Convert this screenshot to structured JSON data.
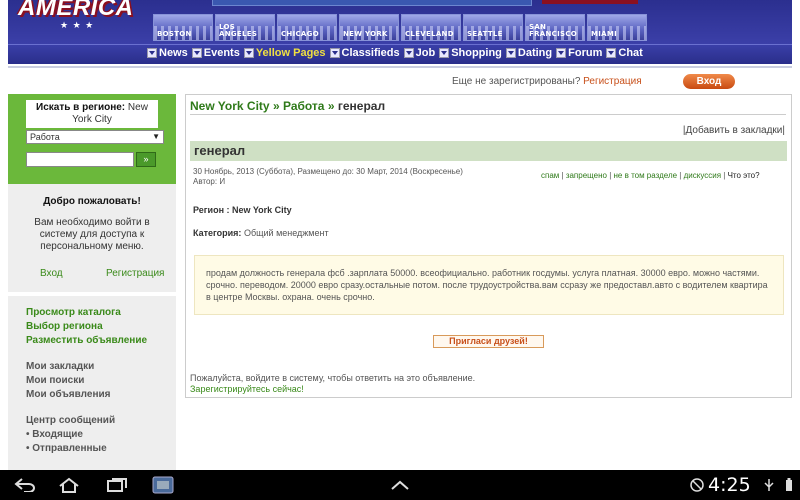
{
  "header": {
    "logo_text": "AMERICA",
    "logo_stars": "★ ★ ★",
    "cities": [
      "Boston",
      "Los Angeles",
      "Chicago",
      "New York",
      "Cleveland",
      "Seattle",
      "San Francisco",
      "Miami"
    ],
    "nav": [
      "News",
      "Events",
      "Yellow Pages",
      "Classifieds",
      "Job",
      "Shopping",
      "Dating",
      "Forum",
      "Chat"
    ],
    "nav_active": "Yellow Pages"
  },
  "login_strip": {
    "not_registered": "Еще не зарегистрированы?",
    "register_link": "Регистрация",
    "login_button": "Вход"
  },
  "sidebar": {
    "search_label": "Искать в регионе:",
    "search_region": "New York City",
    "category_select": "Работа",
    "search_go": "»",
    "welcome_title": "Добро пожаловать!",
    "welcome_text": "Вам необходимо войти в систему для доступа к персональному меню.",
    "login_link": "Вход",
    "register_link": "Регистрация",
    "menu_group1": [
      "Просмотр каталога",
      "Выбор региона",
      "Разместить объявление"
    ],
    "menu_group2": [
      "Мои закладки",
      "Мои поиски",
      "Мои объявления"
    ],
    "menu_group3_title": "Центр сообщений",
    "menu_group3": [
      "• Входящие",
      "• Отправленные"
    ]
  },
  "main": {
    "breadcrumb": [
      "New York City",
      "Работа",
      "генерал"
    ],
    "bookmark": "|Добавить в закладки|",
    "title": "генерал",
    "dates": "30 Ноябрь, 2013 (Суббота), Размещено до: 30 Март, 2014 (Воскресенье)",
    "author": "Автор: И",
    "actions": [
      "спам",
      "запрещено",
      "не в том разделе",
      "дискуссия"
    ],
    "what": "Что это?",
    "region_label": "Регион : New York City",
    "category_label": "Категория:",
    "category_value": "Общий менеджмент",
    "body": "продам должность генерала фсб .зарплата 50000. всеофициально. работник госдумы. услуга платная. 30000 евро. можно частями. срочно. переводом. 20000 евро сразу.остальные потом. после трудоустройства.вам ссразу же предоставл.авто с водителем квартира в центре Москвы. охрана. очень срочно.",
    "invite_button": "Пригласи друзей!",
    "login_note": "Пожалуйста, войдите в систему, чтобы ответить на это объявление.",
    "register_now": "Зарегистрируйтесь сейчас!"
  },
  "system_bar": {
    "time": "4:25",
    "icons": [
      "back-icon",
      "home-icon",
      "recent-apps-icon",
      "screenshot-icon",
      "menu-up-icon",
      "no-sim-icon",
      "usb-icon",
      "battery-icon"
    ]
  },
  "colors": {
    "nav_bg": "#2b2f8f",
    "green_accent": "#6bb83b",
    "link_green": "#2f7a1a",
    "title_bar": "#cfe0c4",
    "body_box": "#fffbe6",
    "orange": "#c8501a"
  }
}
